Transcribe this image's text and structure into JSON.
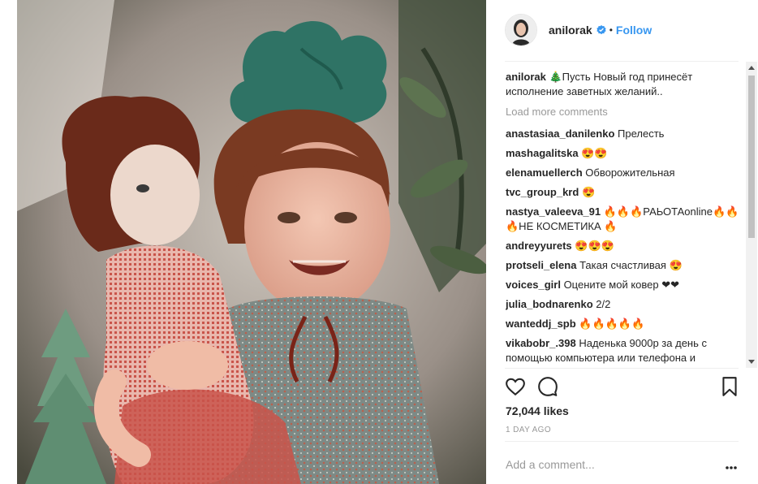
{
  "post": {
    "username": "anilorak",
    "follow_label": "Follow",
    "dot_separator": "•",
    "caption_user": "anilorak",
    "caption_text": "🎄Пусть Новый год принесёт исполнение заветных желаний..",
    "load_more": "Load more comments",
    "comments": [
      {
        "user": "anastasiaa_danilenko",
        "text": "Прелесть"
      },
      {
        "user": "mashagalitska",
        "text": "😍😍"
      },
      {
        "user": "elenamuellerch",
        "text": "Обворожительная"
      },
      {
        "user": "tvc_group_krd",
        "text": "😍"
      },
      {
        "user": "nastya_valeeva_91",
        "text": "🔥🔥🔥РАЬОТАonline🔥🔥 🔥НЕ КОСМЕТИКА 🔥"
      },
      {
        "user": "andreyyurets",
        "text": "😍😍😍"
      },
      {
        "user": "protseli_elena",
        "text": "Такая счастливая 😍"
      },
      {
        "user": "voices_girl",
        "text": "Оцените мой ковер ❤❤"
      },
      {
        "user": "julia_bodnarenko",
        "text": "2/2"
      },
      {
        "user": "wanteddj_spb",
        "text": "🔥🔥🔥🔥🔥"
      },
      {
        "user": "vikabobr_.398",
        "text": "Наденька 9000р за день с помощью компьютера или телефона и"
      }
    ],
    "likes": "72,044 likes",
    "timestamp": "1 DAY AGO",
    "comment_placeholder": "Add a comment...",
    "icons": {
      "verified": "verified-badge-icon",
      "like": "heart-icon",
      "comment": "comment-icon",
      "save": "bookmark-icon",
      "more": "more-options-icon"
    },
    "colors": {
      "link": "#3897f0",
      "text": "#262626",
      "muted": "#999999",
      "separator": "#efefef"
    }
  }
}
